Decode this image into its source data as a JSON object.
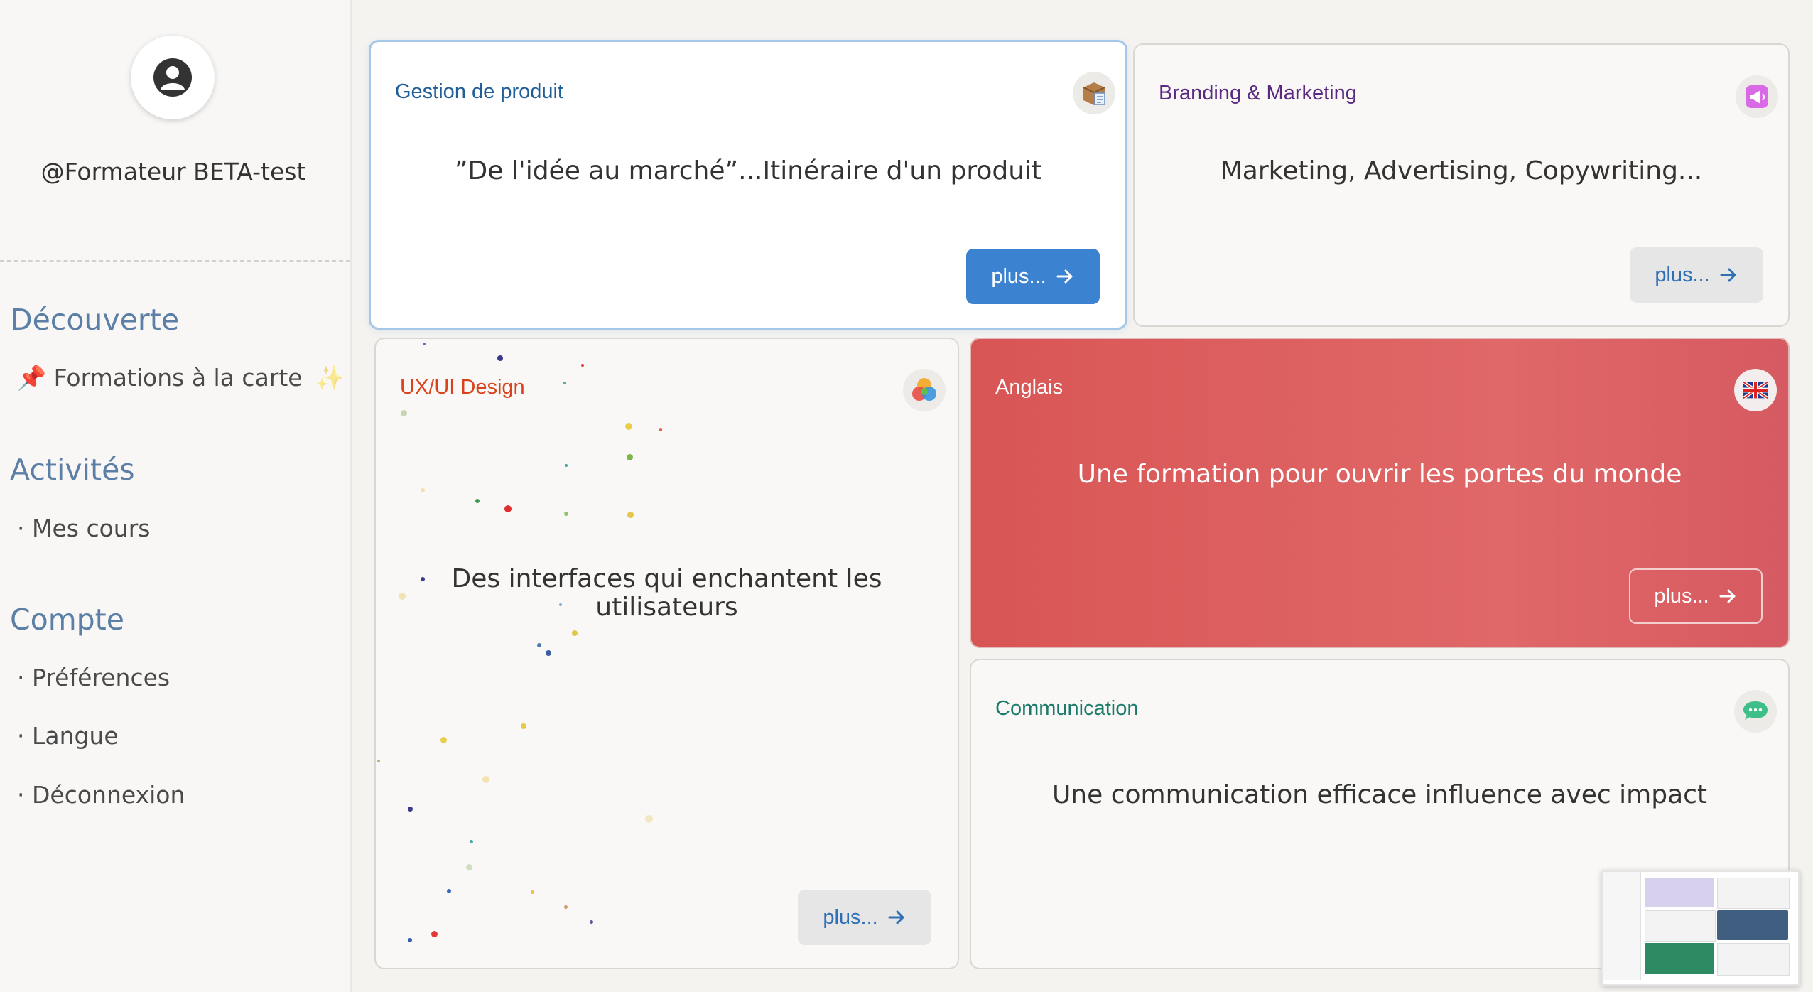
{
  "profile": {
    "username": "@Formateur BETA-test",
    "avatar_icon": "user-icon"
  },
  "sidebar": {
    "sections": [
      {
        "title": "Découverte",
        "items": [
          {
            "label": "Formations à la carte",
            "prefix": "📌",
            "suffix": "✨"
          }
        ]
      },
      {
        "title": "Activités",
        "items": [
          {
            "label": "Mes cours",
            "prefix": "·"
          }
        ]
      },
      {
        "title": "Compte",
        "items": [
          {
            "label": "Préférences",
            "prefix": "·"
          },
          {
            "label": "Langue",
            "prefix": "·"
          },
          {
            "label": "Déconnexion",
            "prefix": "·"
          }
        ]
      }
    ]
  },
  "cards": [
    {
      "title": "Gestion de produit",
      "description": "”De l'idée au marché”...Itinéraire d'un produit",
      "button": "plus...",
      "icon": "package-icon",
      "title_color": "#1f5f99"
    },
    {
      "title": "Branding & Marketing",
      "description": "Marketing, Advertising, Copywriting...",
      "button": "plus...",
      "icon": "megaphone-icon",
      "title_color": "#5a2a82"
    },
    {
      "title": "UX/UI Design",
      "description": "Des interfaces qui enchantent les utilisateurs",
      "button": "plus...",
      "icon": "color-circles-icon",
      "title_color": "#d9421c"
    },
    {
      "title": "Anglais",
      "description": "Une formation pour ouvrir les portes du monde",
      "button": "plus...",
      "icon": "uk-flag-icon",
      "title_color": "#ffffff"
    },
    {
      "title": "Communication",
      "description": "Une communication efficace influence avec impact",
      "icon": "speech-bubble-icon",
      "title_color": "#1c7a6a"
    }
  ],
  "colors": {
    "accent": "#3b82d1",
    "section_title": "#5b7fa6",
    "anglais_bg": "#dc5c5c"
  }
}
